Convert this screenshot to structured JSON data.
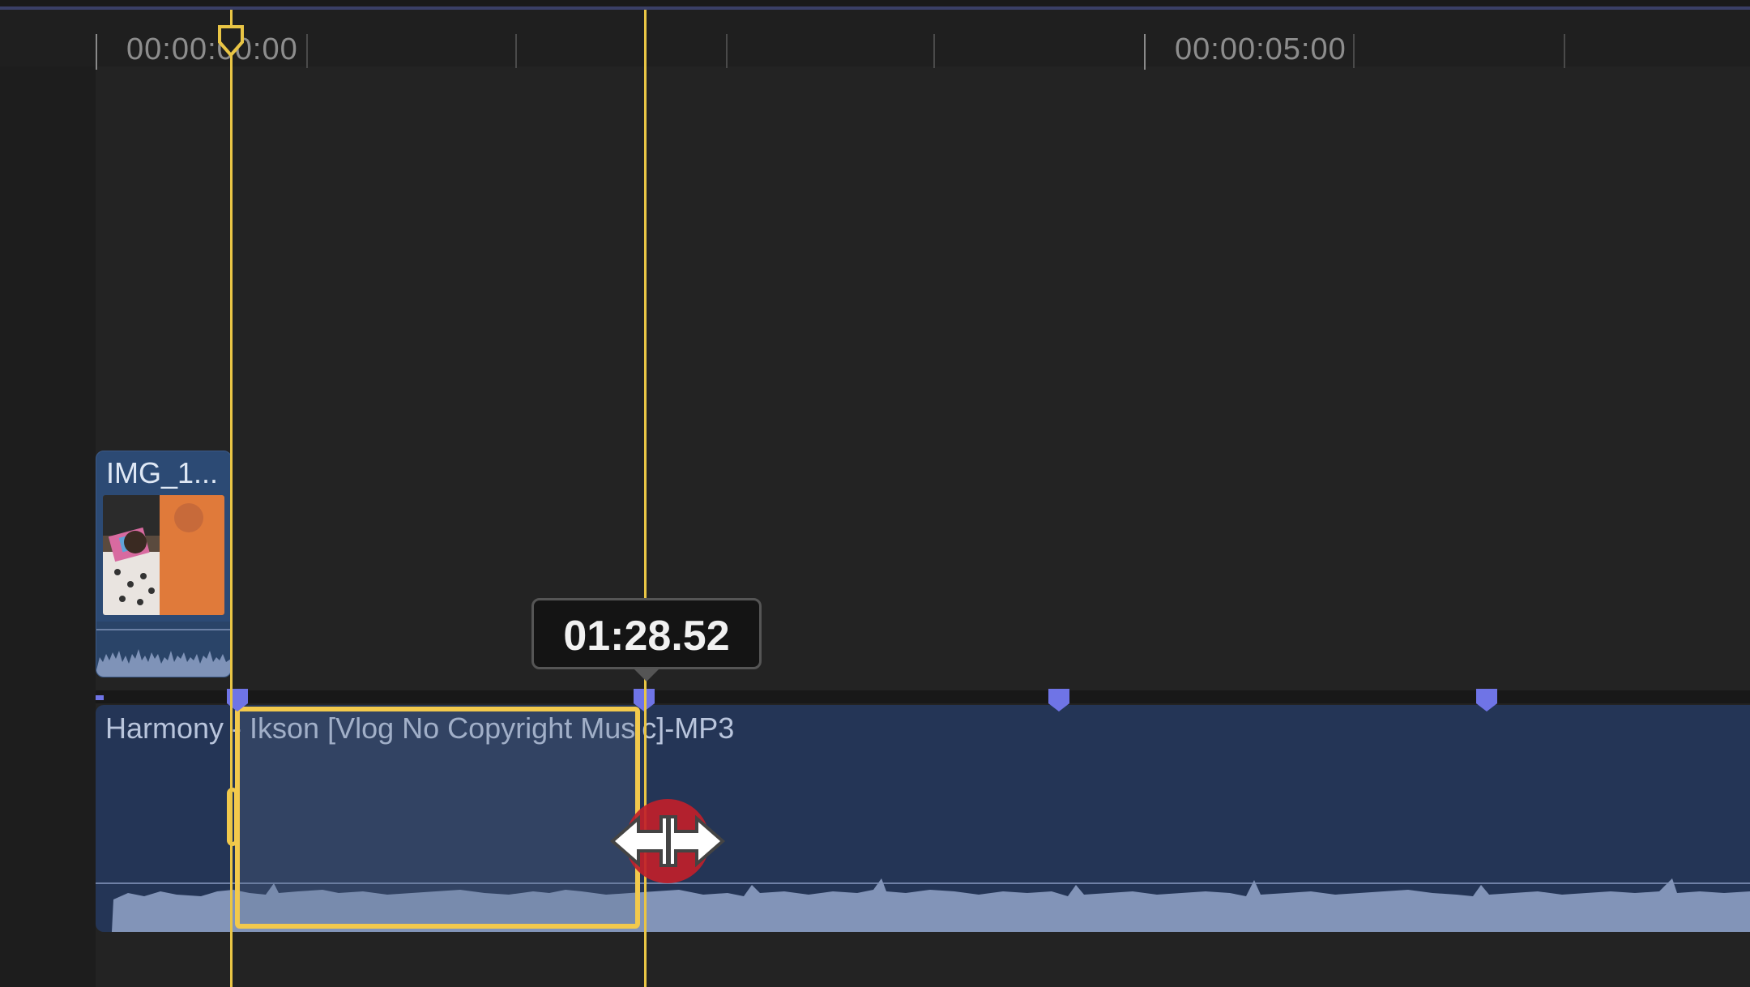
{
  "ruler": {
    "timecode_start": "00:00:00:00",
    "timecode_mid": "00:00:05:00"
  },
  "video_clip": {
    "label": "IMG_1..."
  },
  "audio_clip": {
    "label": "Harmony - Ikson [Vlog No Copyright Music]-MP3"
  },
  "tooltip": {
    "duration": "01:28.52"
  },
  "colors": {
    "playhead": "#e9c545",
    "selection": "#f2c94c",
    "marker": "#6f74e6",
    "audio_clip": "#243556",
    "video_clip": "#2c4a74"
  },
  "icons": {
    "trim_cursor": "resize-horizontal-icon",
    "marker": "marker-icon",
    "playhead_head": "playhead-icon"
  }
}
